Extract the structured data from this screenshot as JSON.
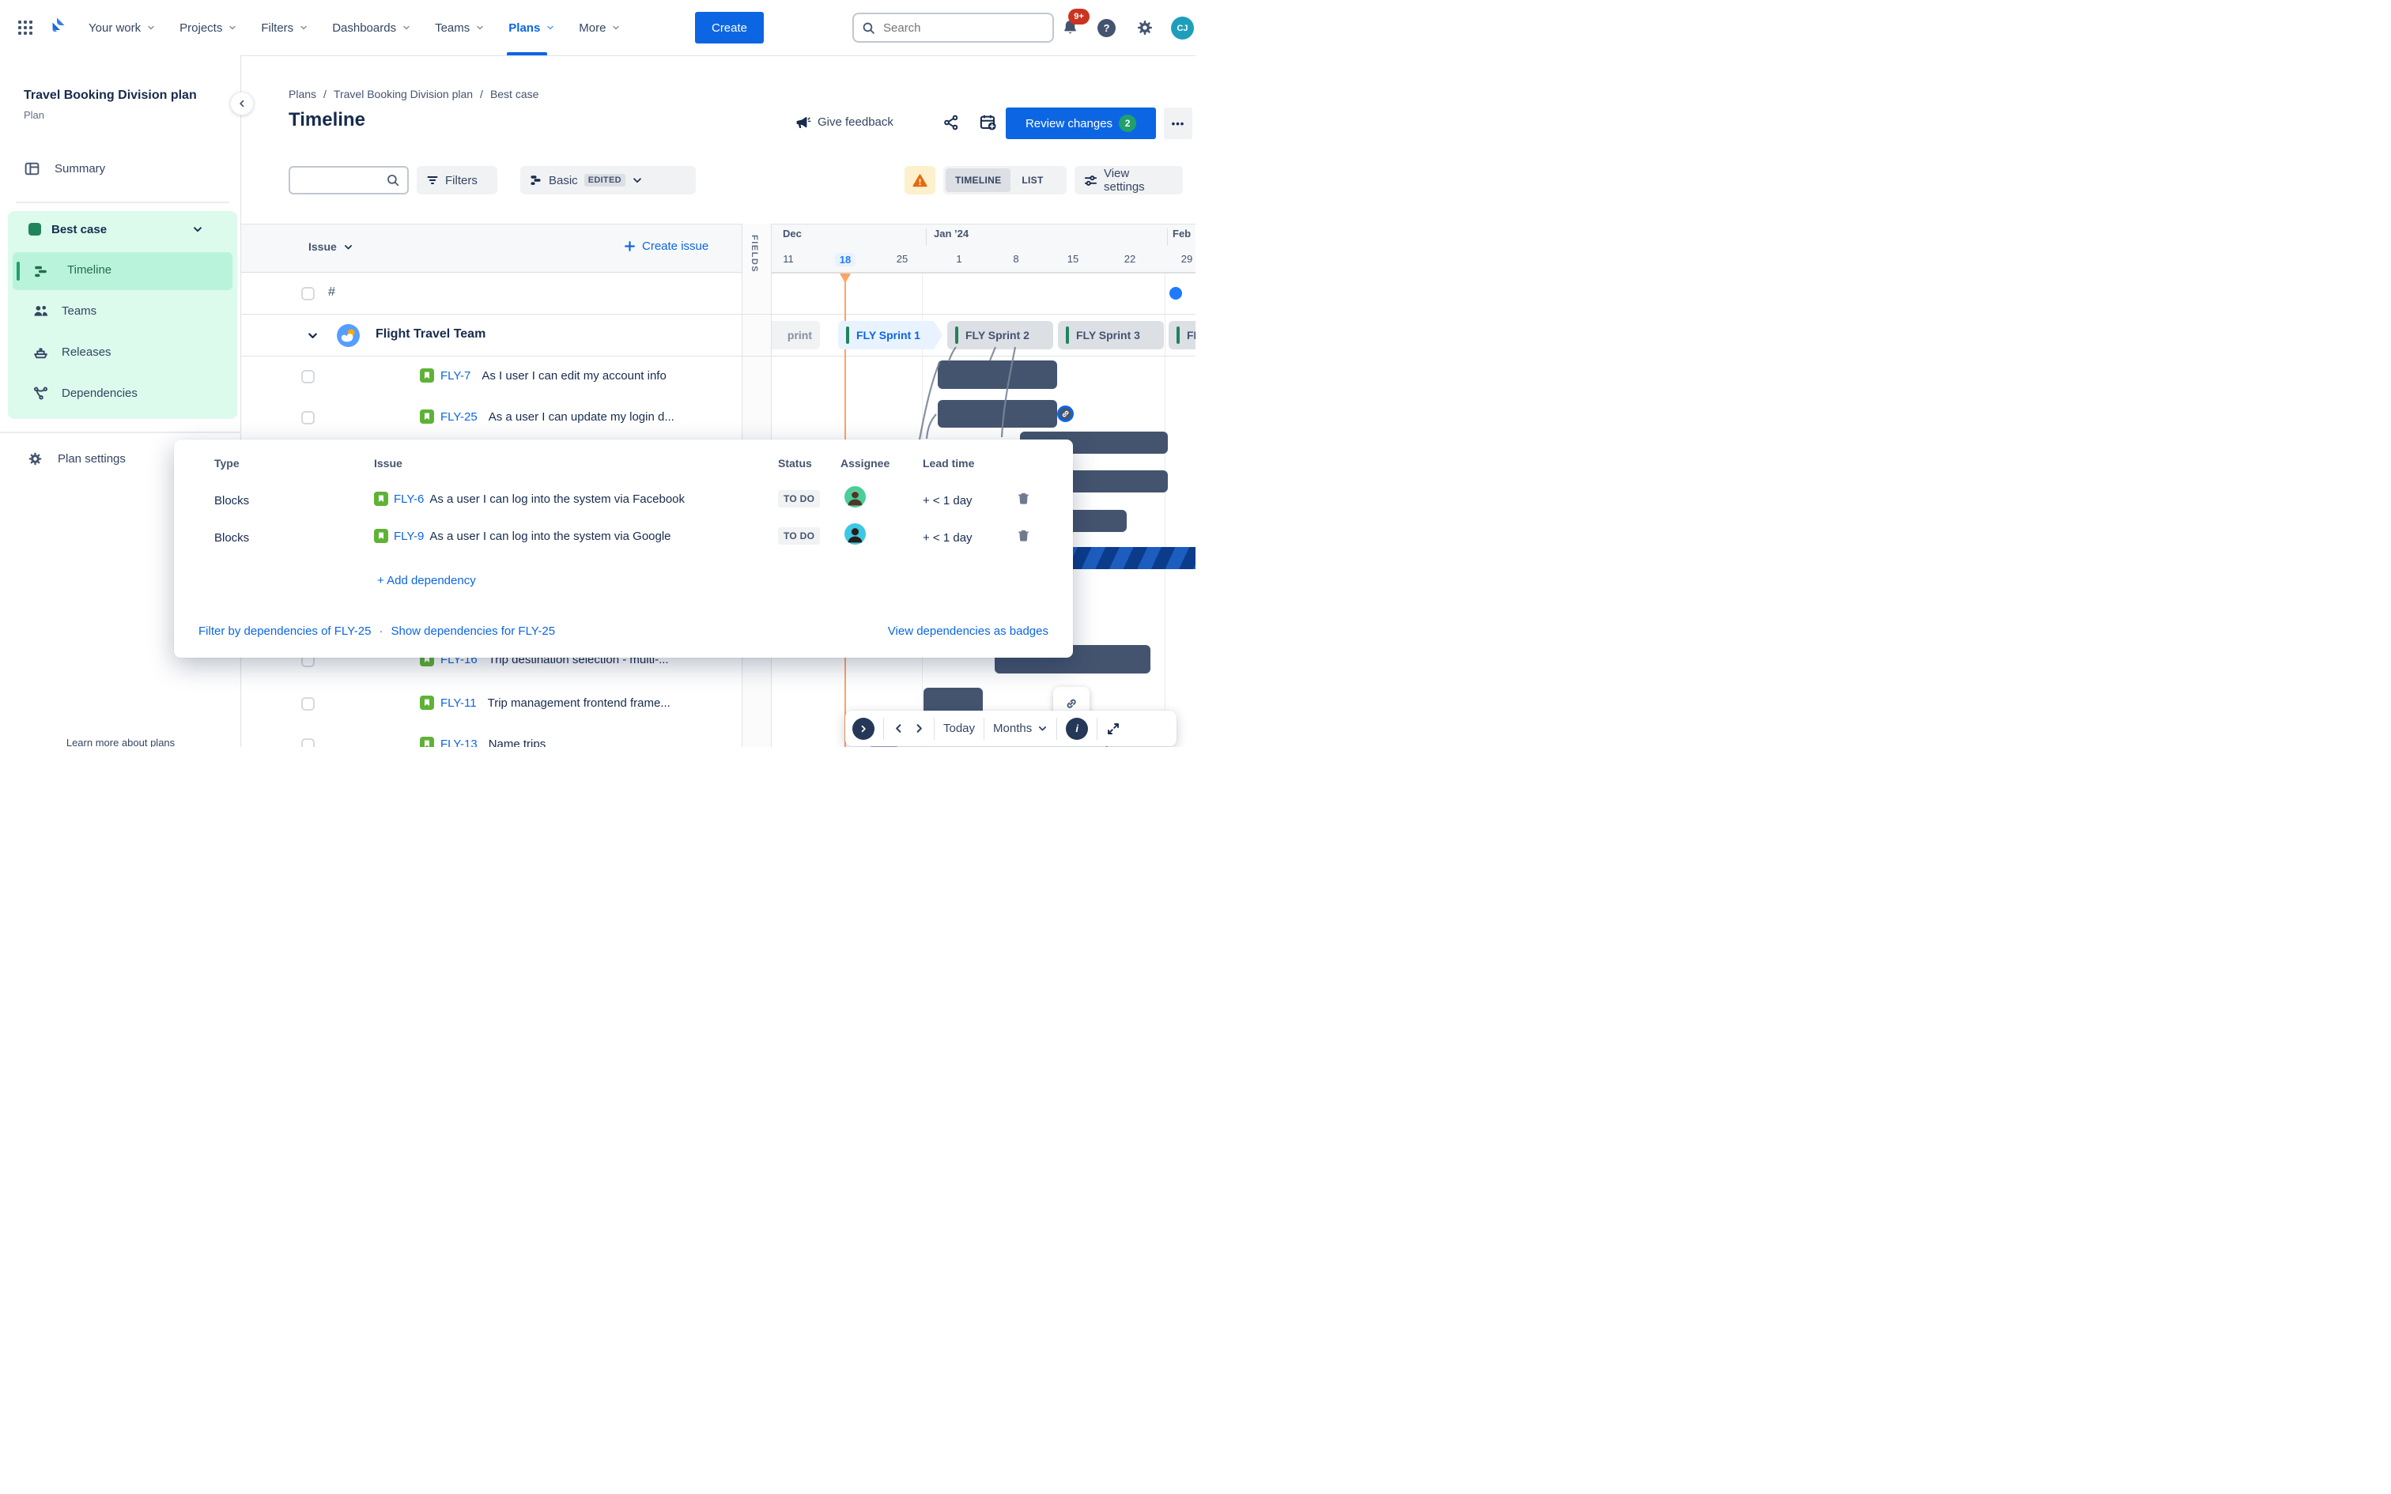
{
  "colors": {
    "accent_blue": "#0C66E4",
    "link_blue": "#1D7AFC",
    "gantt_bar": "#44546F",
    "sprint_green": "#1F845A",
    "today_line": "#FFA35F",
    "stripe_light": "#1D5DBF",
    "stripe_dark": "#0B3C8C",
    "scenario_bg": "#DCFBEC",
    "scenario_selected": "#BAF3DB"
  },
  "nav": {
    "items": [
      "Your work",
      "Projects",
      "Filters",
      "Dashboards",
      "Teams",
      "Plans",
      "More"
    ],
    "active_item": "Plans",
    "create_label": "Create",
    "search_placeholder": "Search",
    "notification_count": "9+",
    "help_glyph": "?",
    "avatar_initials": "CJ"
  },
  "sidebar": {
    "plan_name": "Travel Booking Division plan",
    "plan_type": "Plan",
    "summary": "Summary",
    "scenario_name": "Best case",
    "items": [
      "Timeline",
      "Teams",
      "Releases",
      "Dependencies"
    ],
    "active_item": "Timeline",
    "plan_settings": "Plan settings",
    "learn_more": "Learn more about plans"
  },
  "header": {
    "breadcrumbs": [
      "Plans",
      "Travel Booking Division plan",
      "Best case"
    ],
    "breadcrumb_sep": "/",
    "title": "Timeline",
    "give_feedback": "Give feedback",
    "review_changes": "Review changes",
    "review_count": "2",
    "more_glyph": "•••"
  },
  "toolbar": {
    "filters": "Filters",
    "view_mode": "Basic",
    "edited_badge": "EDITED",
    "tab_timeline": "TIMELINE",
    "tab_list": "LIST",
    "view_settings": "View settings"
  },
  "table": {
    "issue_col": "Issue",
    "create_issue": "Create issue",
    "fields_label": "FIELDS",
    "hash_row": "#",
    "team_name": "Flight Travel Team",
    "issues": [
      {
        "key": "FLY-7",
        "summary": "As I user I can edit my account info"
      },
      {
        "key": "FLY-25",
        "summary": "As a user I can update my login d..."
      },
      {
        "key": "FLY-16",
        "summary": "Trip destination selection - multi-..."
      },
      {
        "key": "FLY-11",
        "summary": "Trip management frontend frame..."
      },
      {
        "key": "FLY-13",
        "summary": "Name trips"
      }
    ]
  },
  "timeline": {
    "months": [
      "Dec",
      "Jan ’24",
      "Feb"
    ],
    "weeks": [
      "11",
      "18",
      "25",
      "1",
      "8",
      "15",
      "22",
      "29"
    ],
    "today_week": "18",
    "sprints": {
      "prev": "print",
      "items": [
        "FLY Sprint 1",
        "FLY Sprint 2",
        "FLY Sprint 3",
        "FLY Sprin"
      ]
    }
  },
  "popup": {
    "col_type": "Type",
    "col_issue": "Issue",
    "col_status": "Status",
    "col_assignee": "Assignee",
    "col_lead": "Lead time",
    "rows": [
      {
        "type": "Blocks",
        "key": "FLY-6",
        "summary": "As a user I can log into the system via Facebook",
        "status": "TO DO",
        "lead_time": "+ < 1 day"
      },
      {
        "type": "Blocks",
        "key": "FLY-9",
        "summary": "As a user I can log into the system via Google",
        "status": "TO DO",
        "lead_time": "+ < 1 day"
      }
    ],
    "add_dependency": "+ Add dependency",
    "filter_link": "Filter by dependencies of FLY-25",
    "link_sep": "·",
    "show_link": "Show dependencies for FLY-25",
    "badges_link": "View dependencies as badges"
  },
  "controls": {
    "today": "Today",
    "zoom_level": "Months",
    "info_glyph": "i"
  }
}
